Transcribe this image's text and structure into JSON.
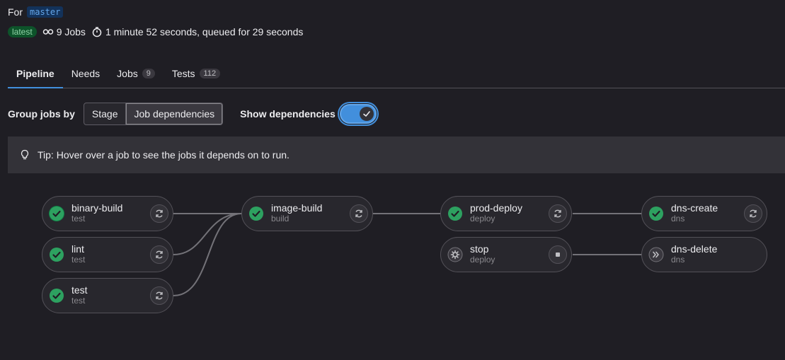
{
  "header": {
    "for_label": "For",
    "branch": "master",
    "latest_badge": "latest",
    "jobs_count": "9 Jobs",
    "duration": "1 minute 52 seconds, queued for 29 seconds"
  },
  "tabs": [
    {
      "label": "Pipeline",
      "count": null
    },
    {
      "label": "Needs",
      "count": null
    },
    {
      "label": "Jobs",
      "count": "9"
    },
    {
      "label": "Tests",
      "count": "112"
    }
  ],
  "controls": {
    "group_label": "Group jobs by",
    "stage_button": "Stage",
    "deps_button": "Job dependencies",
    "show_deps_label": "Show dependencies",
    "show_deps_on": true
  },
  "tip": {
    "text": "Tip: Hover over a job to see the jobs it depends on to run."
  },
  "jobs": [
    {
      "name": "binary-build",
      "stage": "test",
      "status": "success",
      "action": "retry"
    },
    {
      "name": "lint",
      "stage": "test",
      "status": "success",
      "action": "retry"
    },
    {
      "name": "test",
      "stage": "test",
      "status": "success",
      "action": "retry"
    },
    {
      "name": "image-build",
      "stage": "build",
      "status": "success",
      "action": "retry"
    },
    {
      "name": "prod-deploy",
      "stage": "deploy",
      "status": "success",
      "action": "retry"
    },
    {
      "name": "stop",
      "stage": "deploy",
      "status": "manual",
      "action": "stop"
    },
    {
      "name": "dns-create",
      "stage": "dns",
      "status": "success",
      "action": "retry"
    },
    {
      "name": "dns-delete",
      "stage": "dns",
      "status": "skipped",
      "action": "none"
    }
  ],
  "colors": {
    "success": "#108548",
    "accent": "#428fdc",
    "link_line": "#737278"
  }
}
